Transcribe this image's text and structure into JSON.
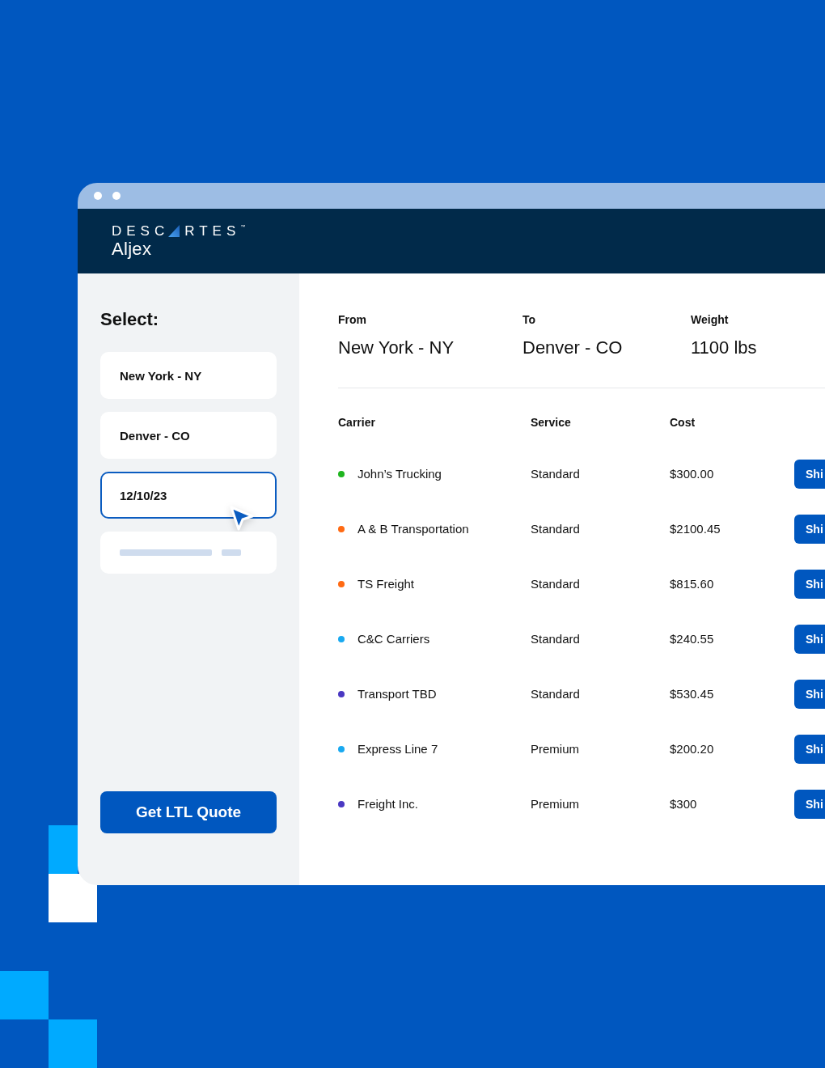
{
  "header": {
    "logo": {
      "wordmark_start": "DESC",
      "wordmark_end": "RTES",
      "trademark": "™",
      "product": "Aljex"
    }
  },
  "sidebar": {
    "title": "Select:",
    "fields": [
      {
        "kind": "text",
        "value": "New York - NY",
        "selected": false
      },
      {
        "kind": "text",
        "value": "Denver - CO",
        "selected": false
      },
      {
        "kind": "text",
        "value": "12/10/23",
        "selected": true
      },
      {
        "kind": "skeleton",
        "selected": false
      }
    ],
    "button": "Get LTL Quote"
  },
  "route": [
    {
      "label": "From",
      "value": "New York - NY"
    },
    {
      "label": "To",
      "value": "Denver - CO"
    },
    {
      "label": "Weight",
      "value": "1100 lbs"
    }
  ],
  "table": {
    "columns": [
      "Carrier",
      "Service",
      "Cost"
    ],
    "rows": [
      {
        "carrier": "John’s Trucking",
        "color": "#1fb51f",
        "service": "Standard",
        "cost": "$300.00",
        "action": "Shi"
      },
      {
        "carrier": "A & B Transportation",
        "color": "#ff6a13",
        "service": "Standard",
        "cost": "$2100.45",
        "action": "Shi"
      },
      {
        "carrier": "TS Freight",
        "color": "#ff6a13",
        "service": "Standard",
        "cost": "$815.60",
        "action": "Shi"
      },
      {
        "carrier": "C&C Carriers",
        "color": "#19a9f0",
        "service": "Standard",
        "cost": "$240.55",
        "action": "Shi"
      },
      {
        "carrier": "Transport TBD",
        "color": "#4a38c2",
        "service": "Standard",
        "cost": "$530.45",
        "action": "Shi"
      },
      {
        "carrier": "Express Line 7",
        "color": "#19a9f0",
        "service": "Premium",
        "cost": "$200.20",
        "action": "Shi"
      },
      {
        "carrier": "Freight Inc.",
        "color": "#4a38c2",
        "service": "Premium",
        "cost": "$300",
        "action": "Shi"
      }
    ]
  }
}
